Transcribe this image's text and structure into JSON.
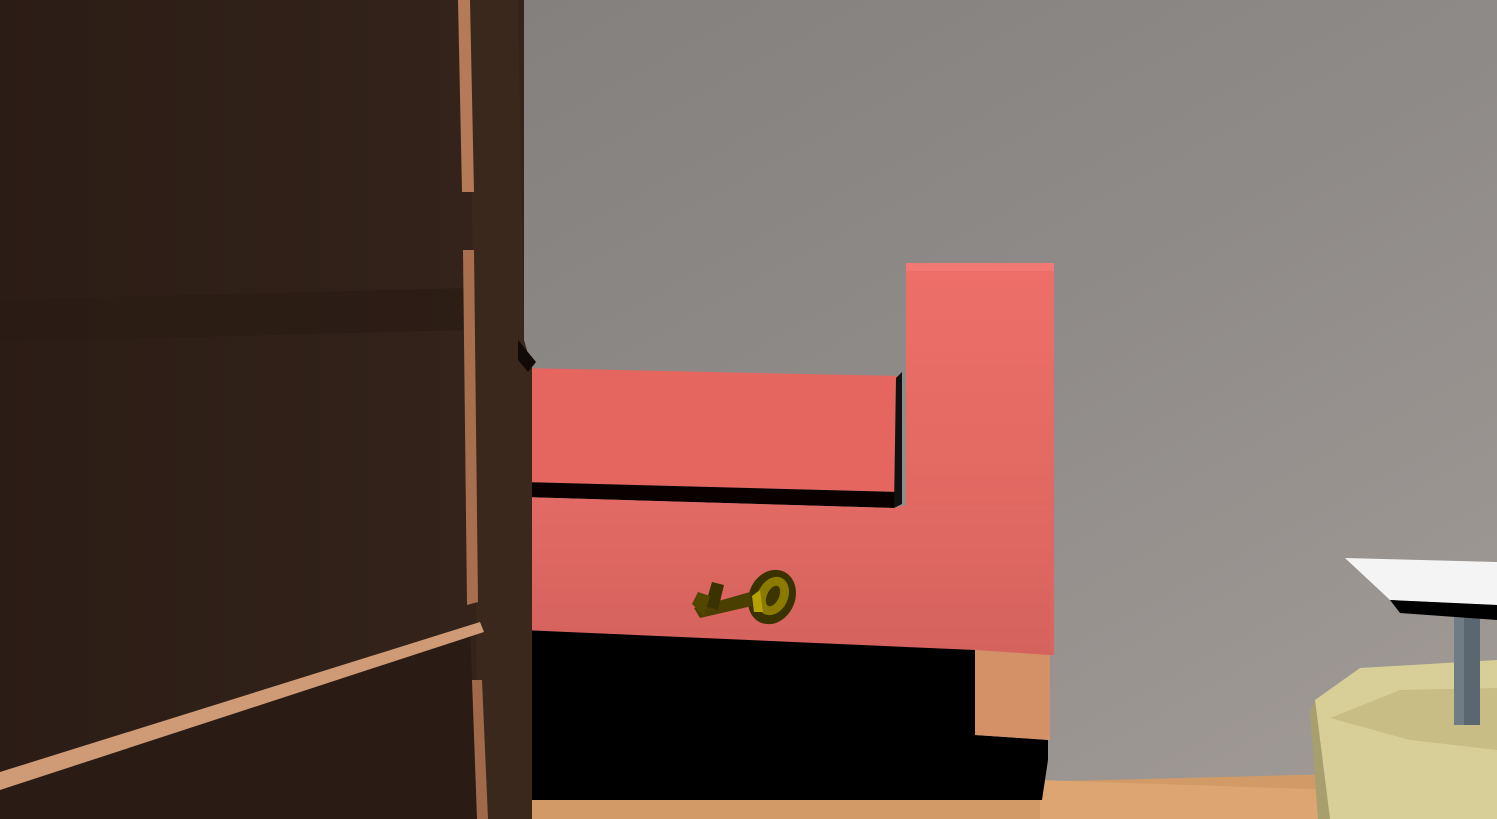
{
  "scene": {
    "view": "first-person",
    "objects": [
      {
        "name": "wooden-door",
        "color": "#2f1f17"
      },
      {
        "name": "pink-sofa",
        "color": "#e66b66"
      },
      {
        "name": "golden-key",
        "color": "#8a7a00"
      },
      {
        "name": "desk-lamp",
        "color": "#d8cf98"
      },
      {
        "name": "wall",
        "color": "#8f8a88"
      },
      {
        "name": "floor",
        "color": "#d9a26c"
      }
    ]
  }
}
